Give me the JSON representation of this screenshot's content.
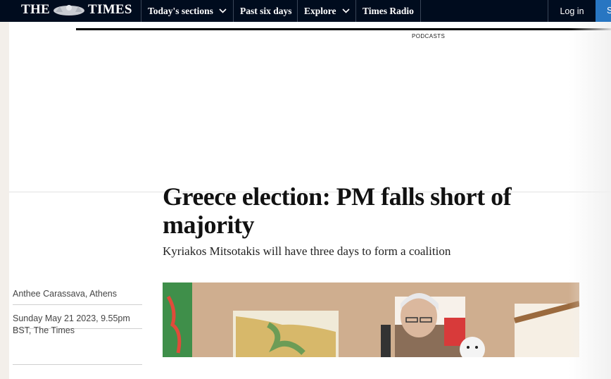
{
  "nav": {
    "logo": {
      "left": "THE",
      "right": "TIMES"
    },
    "items": [
      {
        "label": "Today's sections",
        "has_dropdown": true
      },
      {
        "label": "Past six days",
        "has_dropdown": false
      },
      {
        "label": "Explore",
        "has_dropdown": true
      },
      {
        "label": "Times Radio",
        "has_dropdown": false
      }
    ],
    "login_label": "Log in",
    "subscribe_label": "S"
  },
  "ad": {
    "label": "PODCASTS"
  },
  "article": {
    "headline": "Greece election: PM falls short of majority",
    "standfirst": "Kyriakos Mitsotakis will have three days to form a coalition",
    "author": "Anthee Carassava, Athens",
    "date": "Sunday May 21 2023, 9.55pm BST, The Times"
  },
  "colors": {
    "nav_bg": "#000c1e",
    "subscribe_bg": "#2876c2",
    "page_bg": "#ffffff",
    "outer_bg": "#f3efea"
  }
}
